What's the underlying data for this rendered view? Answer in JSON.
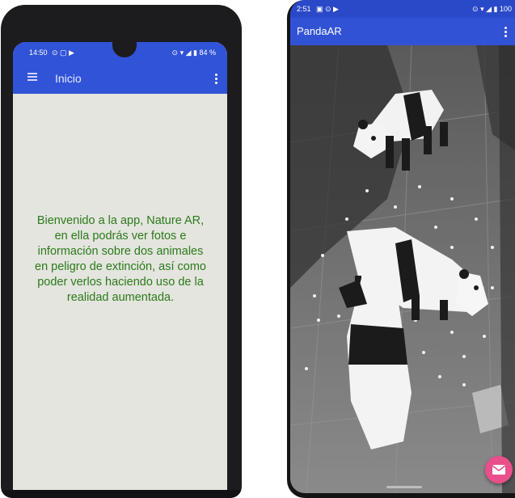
{
  "left_phone": {
    "status_bar": {
      "time": "14:50",
      "icons": "⊙ ▢ ▶",
      "right": "⊙ ▾ ◢ ▮ 84 %"
    },
    "app_bar": {
      "title": "Inicio"
    },
    "welcome_text": "Bienvenido a la app, Nature AR, en ella podrás ver fotos e información sobre dos animales en peligro de extinción, así como poder verlos haciendo uso de la realidad aumentada."
  },
  "right_phone": {
    "status_bar": {
      "time": "2:51",
      "icons": "▣ ⊙ ▶",
      "right": "⊙ ▾ ◢ ▮ 100"
    },
    "app_bar": {
      "title": "PandaAR"
    }
  },
  "colors": {
    "app_bar": "#3153d8",
    "welcome_text": "#2c7a1d",
    "fab": "#e94f8a"
  }
}
